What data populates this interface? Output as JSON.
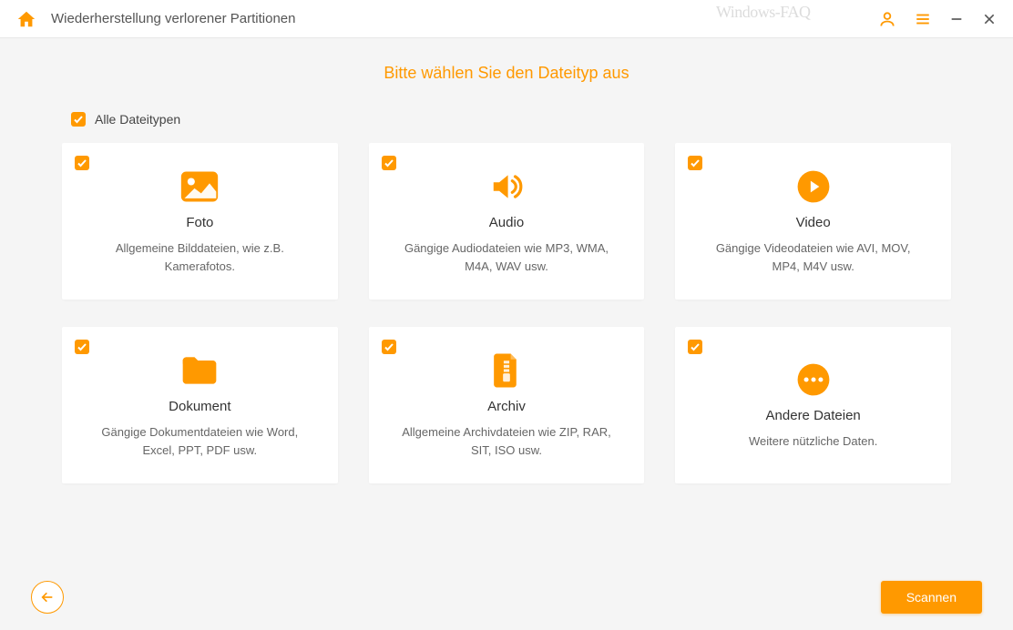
{
  "titlebar": {
    "title": "Wiederherstellung verlorener Partitionen",
    "watermark": "Windows-FAQ"
  },
  "heading": "Bitte wählen Sie den Dateityp aus",
  "all_types_label": "Alle Dateitypen",
  "cards": [
    {
      "title": "Foto",
      "desc": "Allgemeine Bilddateien, wie z.B. Kamerafotos."
    },
    {
      "title": "Audio",
      "desc": "Gängige Audiodateien wie MP3, WMA, M4A, WAV usw."
    },
    {
      "title": "Video",
      "desc": "Gängige Videodateien wie AVI, MOV, MP4, M4V usw."
    },
    {
      "title": "Dokument",
      "desc": "Gängige Dokumentdateien wie Word, Excel, PPT, PDF usw."
    },
    {
      "title": "Archiv",
      "desc": "Allgemeine Archivdateien wie ZIP, RAR, SIT, ISO usw."
    },
    {
      "title": "Andere Dateien",
      "desc": "Weitere nützliche Daten."
    }
  ],
  "scan_label": "Scannen"
}
